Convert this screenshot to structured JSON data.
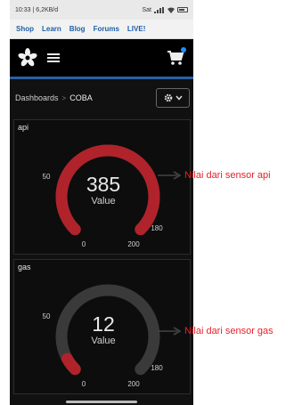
{
  "status": {
    "left": "10:33 | 6,2KB/d",
    "right": "Sat"
  },
  "nav": {
    "links": [
      "Shop",
      "Learn",
      "Blog",
      "Forums",
      "LIVE!"
    ],
    "link_color": "#1f5fa8"
  },
  "breadcrumb": {
    "root": "Dashboards",
    "separator": ">",
    "current": "COBA"
  },
  "blocks": [
    {
      "title": "api",
      "value": "385",
      "value_label": "Value",
      "min": 0,
      "max": 200,
      "tick_low": "50",
      "tick_high": "180",
      "label_min": "0",
      "label_max": "200",
      "fill_fraction": 1.0,
      "color": "#b0232b"
    },
    {
      "title": "gas",
      "value": "12",
      "value_label": "Value",
      "min": 0,
      "max": 200,
      "tick_low": "50",
      "tick_high": "180",
      "label_min": "0",
      "label_max": "200",
      "fill_fraction": 0.06,
      "color": "#b0232b"
    }
  ],
  "annotations": {
    "api": "Nilai dari sensor api",
    "gas": "Nilai dari sensor gas",
    "color": "#e8212a"
  },
  "gauge_track_color": "#3a3a3a"
}
